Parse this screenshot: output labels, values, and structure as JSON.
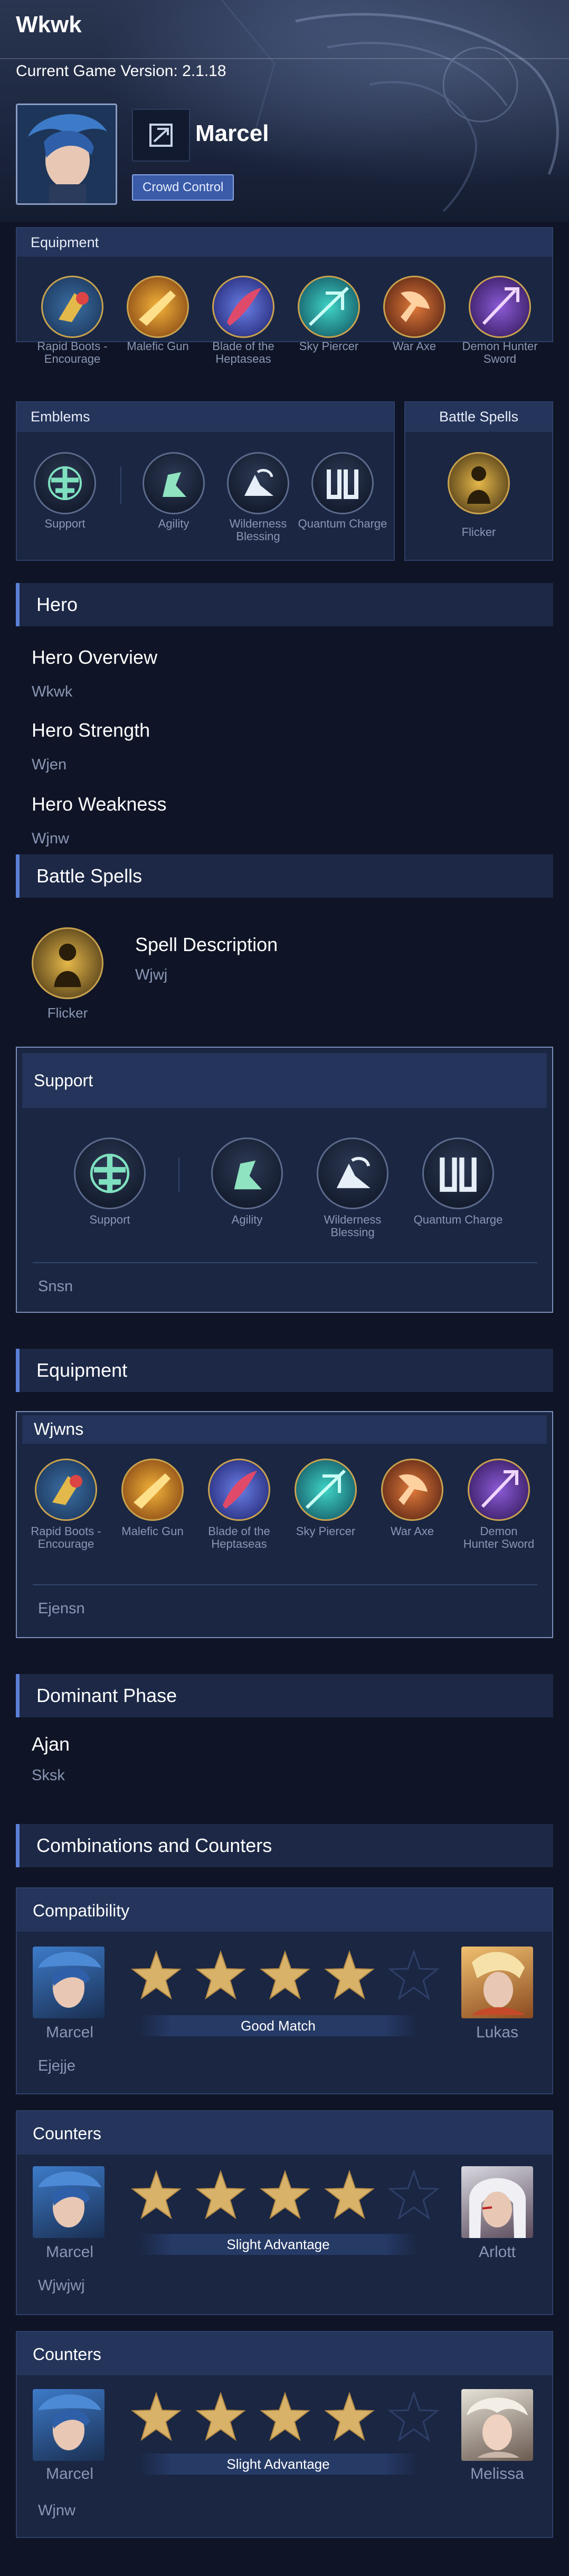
{
  "page": {
    "title": "Wkwk",
    "game_version": "Current Game Version: 2.1.18"
  },
  "hero": {
    "name": "Marcel",
    "role": "Crowd Control"
  },
  "equipment_panel": {
    "title": "Equipment",
    "items": [
      {
        "label": "Rapid Boots - Encourage",
        "icon": "rapid-boots-icon"
      },
      {
        "label": "Malefic Gun",
        "icon": "malefic-gun-icon"
      },
      {
        "label": "Blade of the Heptaseas",
        "icon": "blade-heptaseas-icon"
      },
      {
        "label": "Sky Piercer",
        "icon": "sky-piercer-icon"
      },
      {
        "label": "War Axe",
        "icon": "war-axe-icon"
      },
      {
        "label": "Demon Hunter Sword",
        "icon": "demon-hunter-sword-icon"
      }
    ]
  },
  "emblems_panel": {
    "title": "Emblems",
    "items": [
      {
        "label": "Support",
        "icon": "support-emblem-icon"
      },
      {
        "label": "Agility",
        "icon": "agility-talent-icon"
      },
      {
        "label": "Wilderness Blessing",
        "icon": "wilderness-blessing-icon"
      },
      {
        "label": "Quantum Charge",
        "icon": "quantum-charge-icon"
      }
    ]
  },
  "battle_spells_panel": {
    "title": "Battle Spells",
    "spell": "Flicker"
  },
  "hero_section": {
    "title": "Hero",
    "overview_title": "Hero Overview",
    "overview_value": "Wkwk",
    "strength_title": "Hero Strength",
    "strength_value": "Wjen",
    "weakness_title": "Hero Weakness",
    "weakness_value": "Wjnw"
  },
  "battle_spells_section": {
    "title": "Battle Spells",
    "spell": "Flicker",
    "desc_title": "Spell Description",
    "desc_value": "Wjwj"
  },
  "support_section": {
    "title": "Support",
    "items": [
      "Support",
      "Agility",
      "Wilderness Blessing",
      "Quantum Charge"
    ],
    "note": "Snsn"
  },
  "equipment_section": {
    "title": "Equipment",
    "build_name": "Wjwns",
    "items": [
      "Rapid Boots - Encourage",
      "Malefic Gun",
      "Blade of the Heptaseas",
      "Sky Piercer",
      "War Axe",
      "Demon Hunter Sword"
    ],
    "note": "Ejensn"
  },
  "dominant_phase": {
    "title": "Dominant Phase",
    "phase": "Ajan",
    "value": "Sksk"
  },
  "combinations": {
    "title": "Combinations and Counters",
    "cards": [
      {
        "header": "Compatibility",
        "left": "Marcel",
        "right": "Lukas",
        "rating": 4,
        "max": 5,
        "match": "Good Match",
        "note": "Ejejje"
      },
      {
        "header": "Counters",
        "left": "Marcel",
        "right": "Arlott",
        "rating": 4,
        "max": 5,
        "match": "Slight Advantage",
        "note": "Wjwjwj"
      },
      {
        "header": "Counters",
        "left": "Marcel",
        "right": "Melissa",
        "rating": 4,
        "max": 5,
        "match": "Slight Advantage",
        "note": "Wjnw"
      }
    ]
  },
  "colors": {
    "background": "#0f1526",
    "panel": "#1a2642",
    "accent": "#5a7fd6",
    "star_gold": "#d9b26a",
    "muted_text": "#8a96b4"
  }
}
